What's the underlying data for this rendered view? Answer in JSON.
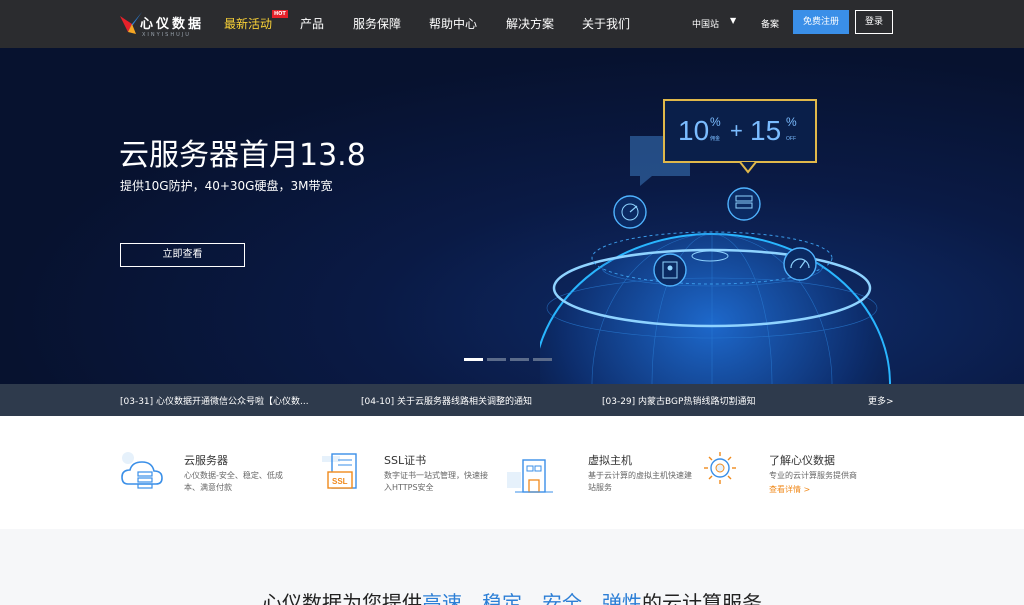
{
  "header": {
    "logo_text": "心仪数据",
    "logo_sub": "XINYISHUJU",
    "nav": [
      {
        "label": "最新活动",
        "active": true,
        "badge": "HOT"
      },
      {
        "label": "产品"
      },
      {
        "label": "服务保障"
      },
      {
        "label": "帮助中心"
      },
      {
        "label": "解决方案"
      },
      {
        "label": "关于我们"
      }
    ],
    "region": "中国站",
    "region_caret": "▼",
    "beian": "备案",
    "register": "免费注册",
    "login": "登录"
  },
  "hero": {
    "title": "云服务器首月13.8",
    "subtitle": "提供10G防护，40+30G硬盘，3M带宽",
    "button": "立即查看",
    "promo": {
      "a": "10",
      "a_small": "佣金",
      "plus": "+",
      "b": "15",
      "b_small": "OFF",
      "pct": "%"
    },
    "slides": 4,
    "active_slide": 0
  },
  "news": {
    "items": [
      "[03-31] 心仪数据开通微信公众号啦【心仪数...",
      "[04-10] 关于云服务器线路相关调整的通知",
      "[03-29] 内蒙古BGP热销线路切割通知"
    ],
    "more": "更多>"
  },
  "features": [
    {
      "icon": "cloud-server-icon",
      "title": "云服务器",
      "desc": "心仪数据-安全、稳定、低成本、满意付款"
    },
    {
      "icon": "ssl-certificate-icon",
      "title": "SSL证书",
      "desc": "数字证书一站式管理，快速接入HTTPS安全",
      "icon_text": "SSL"
    },
    {
      "icon": "virtual-host-icon",
      "title": "虚拟主机",
      "desc": "基于云计算的虚拟主机快速建站服务"
    },
    {
      "icon": "about-sun-icon",
      "title": "了解心仪数据",
      "desc": "专业的云计算服务提供商",
      "link": "查看详情 >"
    }
  ],
  "bottom": {
    "prefix": "心仪数据为您提供",
    "words": [
      "高速",
      "稳定",
      "安全",
      "弹性"
    ],
    "suffix": "的云计算服务"
  },
  "colors": {
    "header_bg": "#2b2c2f",
    "accent_yellow": "#fbd337",
    "register_blue": "#3a8fe8",
    "news_bg": "#2e3a4c",
    "highlight_blue": "#2d7fd6",
    "link_orange": "#f08a1c"
  }
}
